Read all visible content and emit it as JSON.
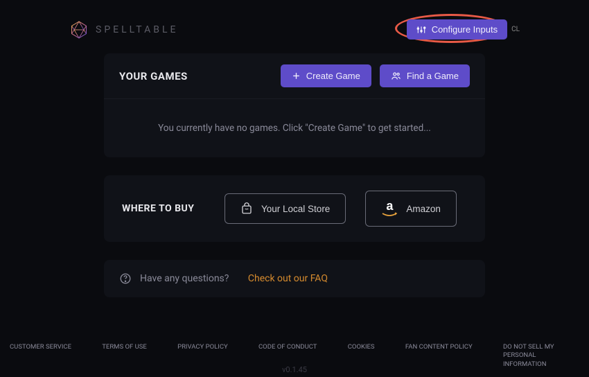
{
  "brand": {
    "name": "SPELLTABLE"
  },
  "header": {
    "configure_label": "Configure Inputs",
    "cl_badge": "CL"
  },
  "games": {
    "title": "YOUR GAMES",
    "create_label": "Create Game",
    "find_label": "Find a Game",
    "empty_message": "You currently have no games. Click \"Create Game\" to get started..."
  },
  "buy": {
    "title": "WHERE TO BUY",
    "local_label": "Your Local Store",
    "amazon_label": "Amazon"
  },
  "faq": {
    "question_text": "Have any questions?",
    "link_text": "Check out our FAQ"
  },
  "footer": {
    "items": [
      "CUSTOMER SERVICE",
      "TERMS OF USE",
      "PRIVACY POLICY",
      "CODE OF CONDUCT",
      "COOKIES",
      "FAN CONTENT POLICY",
      "DO NOT SELL MY PERSONAL INFORMATION"
    ]
  },
  "version": "v0.1.45"
}
